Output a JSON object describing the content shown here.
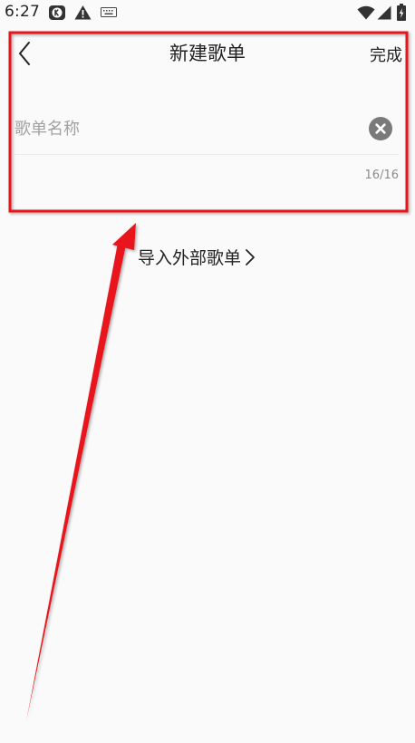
{
  "status_bar": {
    "time": "6:27",
    "icons": [
      "app-k-icon",
      "warning-icon",
      "keyboard-icon",
      "wifi-icon",
      "signal-icon",
      "battery-charging-icon"
    ]
  },
  "header": {
    "title": "新建歌单",
    "done_label": "完成",
    "back_icon": "chevron-left-icon"
  },
  "form": {
    "name_value": "",
    "name_placeholder": "歌单名称",
    "counter": "16/16",
    "clear_icon": "clear-circle-icon"
  },
  "import": {
    "label": "导入外部歌单",
    "icon": "chevron-right-icon"
  },
  "colors": {
    "background": "#fbfafb",
    "text": "#222222",
    "placeholder": "#a2a2a2",
    "clear_icon": "#7a7a7a",
    "annotation": "#e8121b"
  }
}
